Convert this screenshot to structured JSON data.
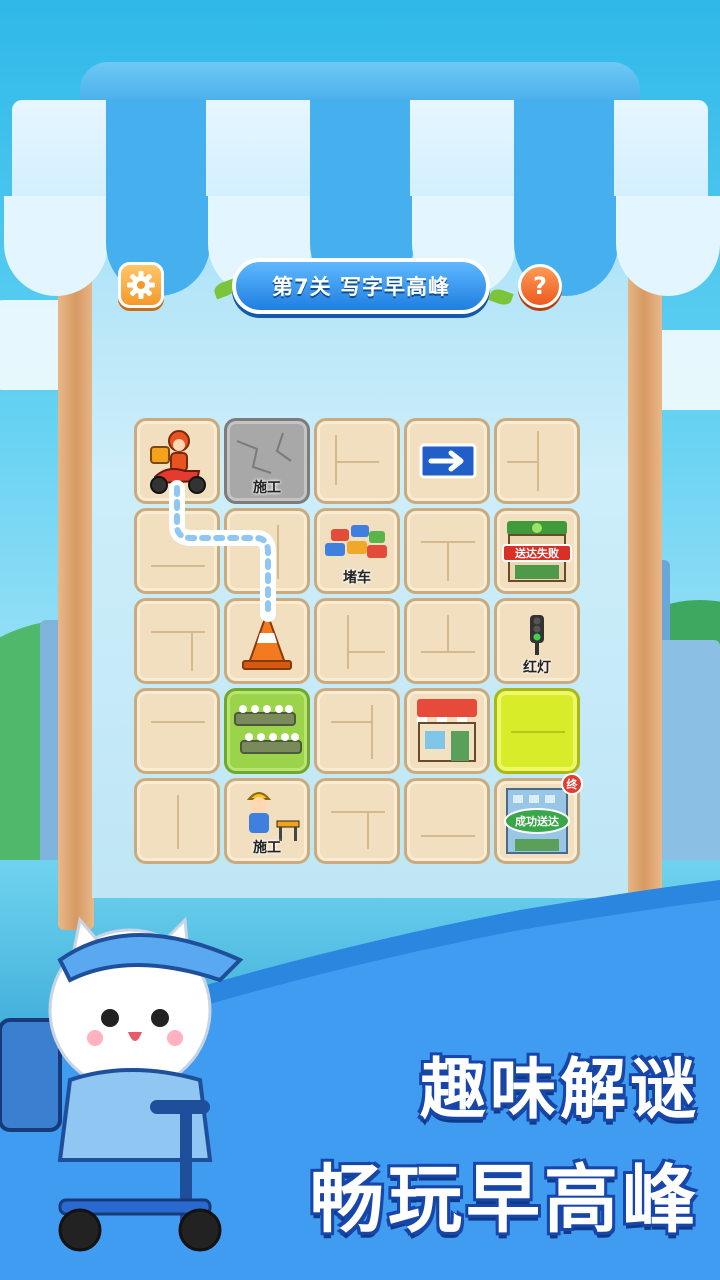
{
  "header": {
    "level_title": "第7关 写字早高峰",
    "settings_icon": "gear-icon",
    "help_icon": "question-icon",
    "help_glyph": "?"
  },
  "board": {
    "rows": 5,
    "cols": 5,
    "tiles": [
      {
        "row": 0,
        "col": 0,
        "type": "start",
        "content": "delivery-scooter-rider",
        "label": ""
      },
      {
        "row": 0,
        "col": 1,
        "type": "stone",
        "content": "construction-stone",
        "label": "施工"
      },
      {
        "row": 0,
        "col": 2,
        "type": "plain",
        "content": "",
        "label": ""
      },
      {
        "row": 0,
        "col": 3,
        "type": "plain",
        "content": "arrow-right-sign",
        "label": ""
      },
      {
        "row": 0,
        "col": 4,
        "type": "plain",
        "content": "",
        "label": ""
      },
      {
        "row": 1,
        "col": 0,
        "type": "plain",
        "content": "",
        "label": ""
      },
      {
        "row": 1,
        "col": 1,
        "type": "plain",
        "content": "",
        "label": ""
      },
      {
        "row": 1,
        "col": 2,
        "type": "plain",
        "content": "traffic-jam-cars",
        "label": "堵车"
      },
      {
        "row": 1,
        "col": 3,
        "type": "plain",
        "content": "",
        "label": ""
      },
      {
        "row": 1,
        "col": 4,
        "type": "plain",
        "content": "shop-delivery-failed",
        "label": "送达失败"
      },
      {
        "row": 2,
        "col": 0,
        "type": "plain",
        "content": "",
        "label": ""
      },
      {
        "row": 2,
        "col": 1,
        "type": "plain",
        "content": "traffic-cone",
        "label": ""
      },
      {
        "row": 2,
        "col": 2,
        "type": "plain",
        "content": "",
        "label": ""
      },
      {
        "row": 2,
        "col": 3,
        "type": "plain",
        "content": "",
        "label": ""
      },
      {
        "row": 2,
        "col": 4,
        "type": "plain",
        "content": "traffic-light",
        "label": "红灯"
      },
      {
        "row": 3,
        "col": 0,
        "type": "plain",
        "content": "",
        "label": ""
      },
      {
        "row": 3,
        "col": 1,
        "type": "grass",
        "content": "flower-planters",
        "label": ""
      },
      {
        "row": 3,
        "col": 2,
        "type": "plain",
        "content": "",
        "label": ""
      },
      {
        "row": 3,
        "col": 3,
        "type": "plain",
        "content": "storefront",
        "label": ""
      },
      {
        "row": 3,
        "col": 4,
        "type": "goal-highlight",
        "content": "",
        "label": ""
      },
      {
        "row": 4,
        "col": 0,
        "type": "plain",
        "content": "",
        "label": ""
      },
      {
        "row": 4,
        "col": 1,
        "type": "plain",
        "content": "construction-worker",
        "label": "施工"
      },
      {
        "row": 4,
        "col": 2,
        "type": "plain",
        "content": "",
        "label": ""
      },
      {
        "row": 4,
        "col": 3,
        "type": "plain",
        "content": "",
        "label": ""
      },
      {
        "row": 4,
        "col": 4,
        "type": "end",
        "content": "building-delivered",
        "label": "成功送达",
        "badge": "终"
      }
    ],
    "drawn_path": [
      [
        0,
        0
      ],
      [
        1,
        0
      ],
      [
        1,
        1
      ],
      [
        2,
        1
      ]
    ]
  },
  "promo": {
    "line1": "趣味解谜",
    "line2": "畅玩早高峰",
    "mascot": "cat-courier-on-scooter"
  },
  "colors": {
    "title_pill": "#1f7fe0",
    "awning_blue": "#3aa3e6",
    "tile": "#f1dfbf",
    "goal": "#d9ec2a",
    "slogan_outline": "#1746a8"
  }
}
